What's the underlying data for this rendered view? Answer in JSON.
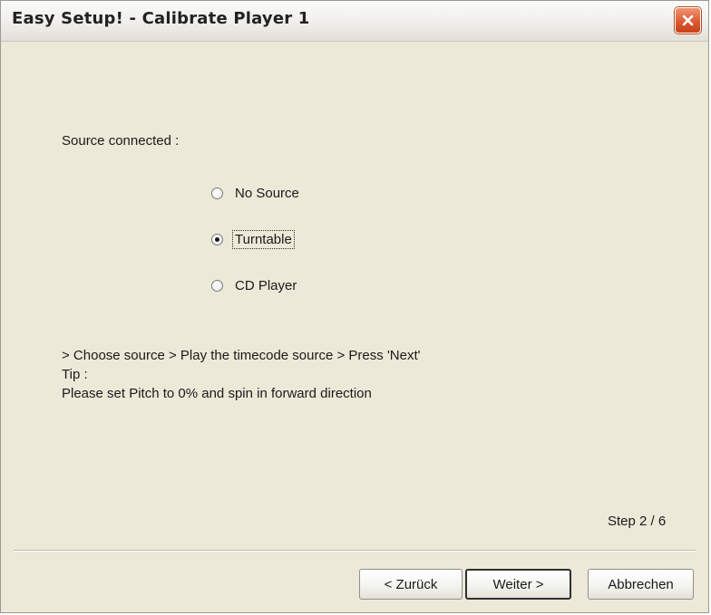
{
  "window": {
    "title": "Easy Setup! - Calibrate Player 1"
  },
  "source": {
    "label": "Source connected :",
    "options": [
      {
        "label": "No Source",
        "checked": false
      },
      {
        "label": "Turntable",
        "checked": true
      },
      {
        "label": "CD Player",
        "checked": false
      }
    ]
  },
  "instructions": {
    "line1": "> Choose source > Play the timecode source > Press 'Next'",
    "line2": "Tip :",
    "line3": "Please set Pitch to 0% and spin in forward direction"
  },
  "step": "Step 2 / 6",
  "buttons": {
    "back": "< Zurück",
    "next": "Weiter >",
    "cancel": "Abbrechen"
  },
  "colors": {
    "dialog_bg": "#ece9d8",
    "close_button": "#d9572f"
  }
}
